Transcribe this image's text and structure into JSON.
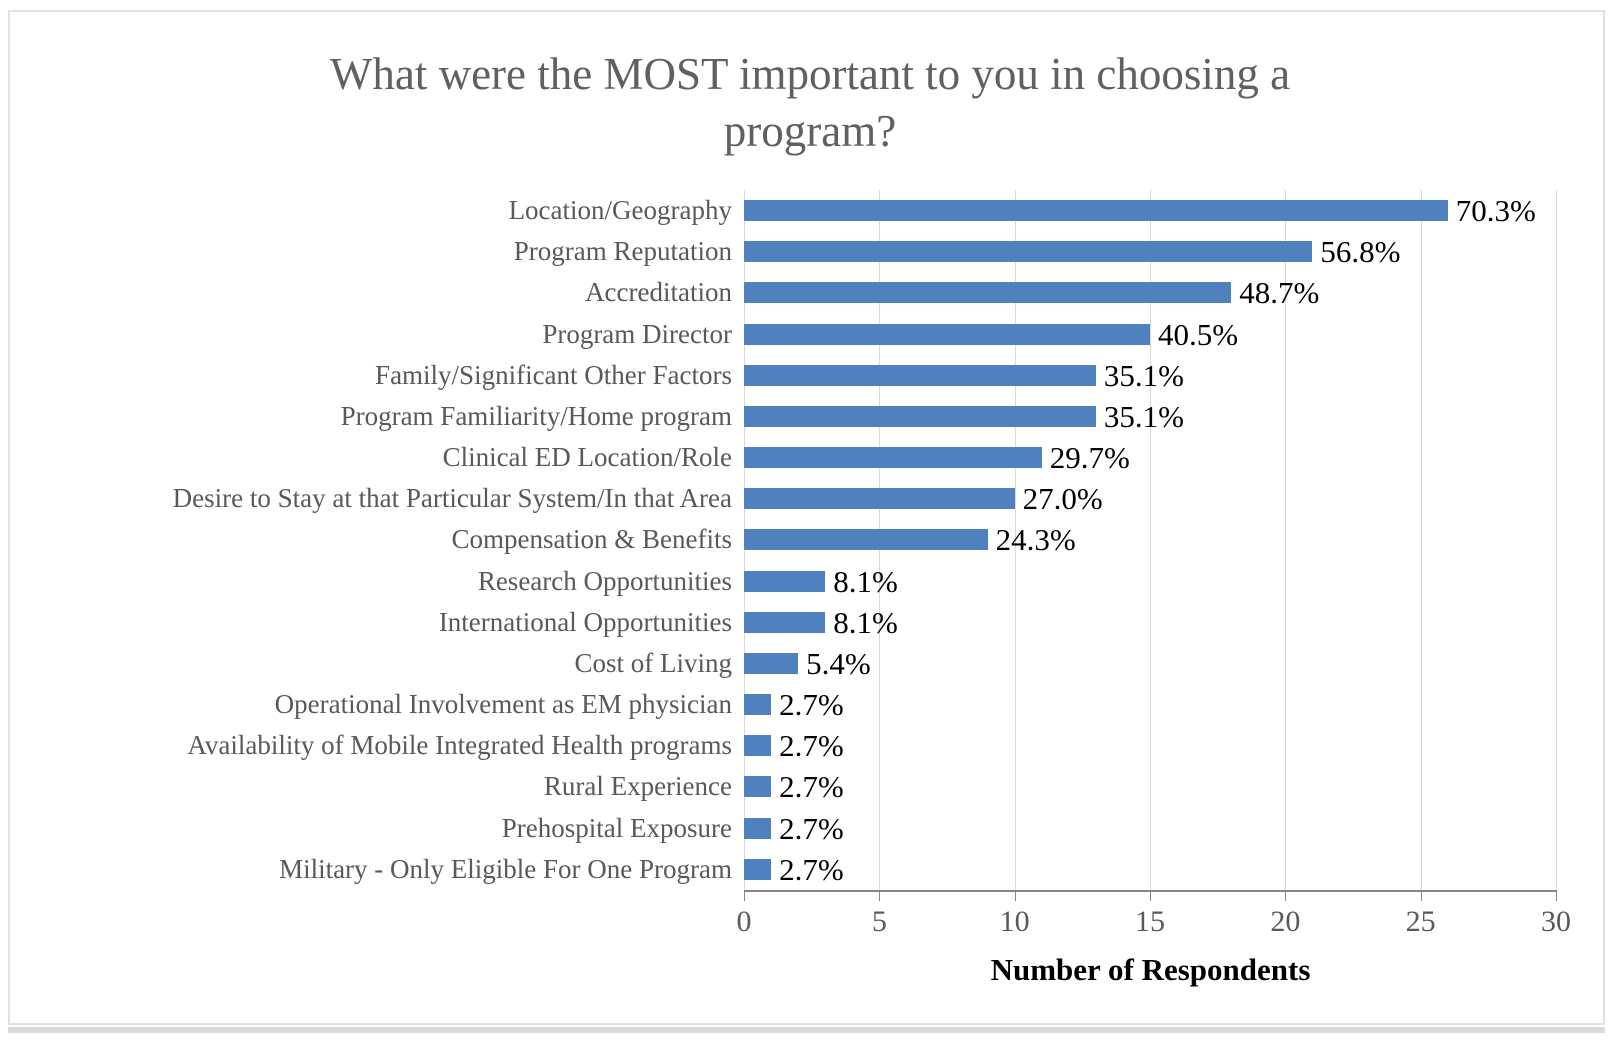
{
  "chart_data": {
    "type": "bar",
    "orientation": "horizontal",
    "title": "What were the MOST important to you in choosing a program?",
    "title_lines": [
      "What were the MOST important to you in choosing a",
      "program?"
    ],
    "xlabel": "Number of Respondents",
    "ylabel": "",
    "xlim": [
      0,
      30
    ],
    "xticks": [
      0,
      5,
      10,
      15,
      20,
      25,
      30
    ],
    "xtick_labels": [
      "0",
      "5",
      "10",
      "15",
      "20",
      "25",
      "30"
    ],
    "grid": "vertical",
    "legend": "none",
    "bar_color": "#4e81bd",
    "categories": [
      "Location/Geography",
      "Program Reputation",
      "Accreditation",
      "Program Director",
      "Family/Significant Other Factors",
      "Program Familiarity/Home program",
      "Clinical ED Location/Role",
      "Desire to Stay at that Particular System/In that Area",
      "Compensation & Benefits",
      "Research Opportunities",
      "International Opportunities",
      "Cost of Living",
      "Operational Involvement as EM physician",
      "Availability of Mobile Integrated Health programs",
      "Rural Experience",
      "Prehospital Exposure",
      "Military - Only Eligible For One Program"
    ],
    "values": [
      26,
      21,
      18,
      15,
      13,
      13,
      11,
      10,
      9,
      3,
      3,
      2,
      1,
      1,
      1,
      1,
      1
    ],
    "data_labels": [
      "70.3%",
      "56.8%",
      "48.7%",
      "40.5%",
      "35.1%",
      "35.1%",
      "29.7%",
      "27.0%",
      "24.3%",
      "8.1%",
      "8.1%",
      "5.4%",
      "2.7%",
      "2.7%",
      "2.7%",
      "2.7%",
      "2.7%"
    ],
    "percentages": [
      70.3,
      56.8,
      48.7,
      40.5,
      35.1,
      35.1,
      29.7,
      27.0,
      24.3,
      8.1,
      8.1,
      5.4,
      2.7,
      2.7,
      2.7,
      2.7,
      2.7
    ]
  },
  "caption_sliver": ""
}
